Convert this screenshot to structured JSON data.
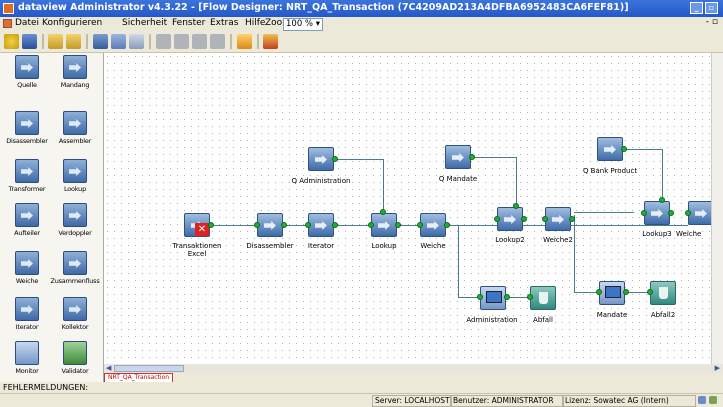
{
  "window": {
    "title": "dataview Administrator v4.3.22 - [Flow Designer: NRT_QA_Transaction    (7C4209AD213A4DFBA6952483CA6FEF81)]"
  },
  "menu": {
    "items": [
      "Datei",
      "Konfigurieren",
      "Sicherheit",
      "Fenster",
      "Extras",
      "Hilfe"
    ],
    "zoom_label": "Zoom",
    "zoom_value": "100 % ▾",
    "right_glyph": "- ▫"
  },
  "palette": {
    "items": [
      "Quelle",
      "Mandang",
      "Disassembler",
      "Assembler",
      "Transformer",
      "Lookup",
      "Aufteiler",
      "Verdoppler",
      "Weiche",
      "Zusammenfluss",
      "Iterator",
      "Kollektor",
      "Monitor",
      "Validator"
    ]
  },
  "canvas": {
    "nodes": [
      {
        "id": "q-admin",
        "label": "Q Administration"
      },
      {
        "id": "q-mandate",
        "label": "Q Mandate"
      },
      {
        "id": "q-bank",
        "label": "Q Bank Product"
      },
      {
        "id": "transaktionen",
        "label": "Transaktionen\nExcel"
      },
      {
        "id": "disassembler",
        "label": "Disassembler"
      },
      {
        "id": "iterator",
        "label": "Iterator"
      },
      {
        "id": "lookup",
        "label": "Lookup"
      },
      {
        "id": "weiche",
        "label": "Weiche"
      },
      {
        "id": "lookup2",
        "label": "Lookup2"
      },
      {
        "id": "weiche2",
        "label": "Weiche2"
      },
      {
        "id": "lookup3",
        "label": "Lookup3"
      },
      {
        "id": "weiche3",
        "label": "Weiche"
      },
      {
        "id": "administration",
        "label": "Administration"
      },
      {
        "id": "abfall",
        "label": "Abfall"
      },
      {
        "id": "mandate",
        "label": "Mandate"
      },
      {
        "id": "abfall2",
        "label": "Abfall2"
      }
    ]
  },
  "tab": {
    "label": "NRT_QA_Transaction"
  },
  "errors": {
    "label": "FEHLERMELDUNGEN:"
  },
  "status": {
    "server": "Server: LOCALHOST",
    "user": "Benutzer: ADMINISTRATOR",
    "license": "Lizenz: Sowatec AG (Intern)"
  },
  "colors": {
    "titlebar": "#2458c8",
    "port": "#1fae32",
    "connector": "#4a7c8a",
    "node": "#3f6ca8"
  }
}
